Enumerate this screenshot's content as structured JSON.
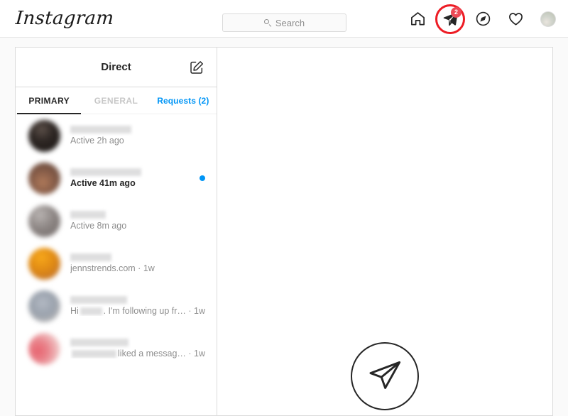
{
  "navbar": {
    "logo": "Instagram",
    "search": {
      "placeholder": "Search",
      "icon": "search-icon"
    },
    "icons": [
      {
        "name": "home-icon",
        "label": "Home"
      },
      {
        "name": "direct-messages-icon",
        "label": "Direct",
        "badge": "2",
        "annotated": true,
        "annotation_color": "#ed1c24"
      },
      {
        "name": "explore-compass-icon",
        "label": "Explore"
      },
      {
        "name": "activity-heart-icon",
        "label": "Activity"
      },
      {
        "name": "profile-avatar",
        "label": "Profile"
      }
    ],
    "badge_color": "#ed4956"
  },
  "direct": {
    "header": {
      "title": "Direct",
      "compose_icon": "compose-pencil-icon"
    },
    "tabs": [
      {
        "label": "PRIMARY",
        "state": "active"
      },
      {
        "label": "GENERAL",
        "state": "inactive"
      },
      {
        "label": "Requests (2)",
        "state": "link"
      }
    ],
    "accent_color": "#0095f6",
    "threads": [
      {
        "name": "",
        "name_redacted": true,
        "name_width": 86,
        "preview": "Active 2h ago",
        "unread": false,
        "unread_dot": false,
        "avatar_gradient": "radial-gradient(circle at 42% 30%, #5c5049 0%, #2e2724 40%, #191513 100%), radial-gradient(circle at 60% 72%, #7a3f3a 0%, #332423 70%)"
      },
      {
        "name": "",
        "name_redacted": true,
        "name_width": 100,
        "preview": "Active 41m ago",
        "unread": true,
        "unread_dot": true,
        "avatar_gradient": "radial-gradient(circle at 45% 62%, #b07a5a 0%, #8a5f4a 40%, #5a4036 100%), radial-gradient(circle at 55% 25%, #cbb29f 0%, #7e5a48 70%)"
      },
      {
        "name": "",
        "name_redacted": true,
        "name_width": 50,
        "preview": "Active 8m ago",
        "unread": false,
        "unread_dot": false,
        "avatar_gradient": "radial-gradient(circle at 36% 30%, #b9b4b2 0%, #8e8785 45%, #6e6664 100%), radial-gradient(circle at 62% 70%, #c0737f 0%, #9a7e84 65%)"
      },
      {
        "name": "",
        "name_redacted": true,
        "name_width": 58,
        "preview": "jennstrends.com · 1w",
        "unread": false,
        "unread_dot": false,
        "avatar_gradient": "radial-gradient(circle at 40% 30%, #f7a81b 0%, #e08a14 45%, #c5762a 80%), radial-gradient(circle at 78% 74%, #6b4b8f 0%, #b4865f 60%)"
      },
      {
        "name": "",
        "name_redacted": true,
        "name_width": 80,
        "preview_prefix": "Hi",
        "preview_redact_width": 54,
        "preview_suffix": ". I'm following up fr… · 1w",
        "unread": false,
        "unread_dot": false,
        "avatar_gradient": "radial-gradient(circle at 45% 40%, #b4bac4 0%, #9aa2ad 45%, #c9c2bc 100%), radial-gradient(circle at 50% 12%, #8d93a4 0%, #b9bec7 60%)"
      },
      {
        "name": "",
        "name_redacted": true,
        "name_width": 82,
        "preview_prefix": "",
        "preview_redact_width": 86,
        "preview_suffix": "liked a messag… · 1w",
        "unread": false,
        "unread_dot": false,
        "avatar_gradient": "radial-gradient(circle at 30% 56%, #e8636f 0%, #e9848c 35%, #f2d3d2 80%), radial-gradient(circle at 70% 55%, #e05a68 0%, #f0cfcd 70%)"
      }
    ]
  },
  "conversation": {
    "empty_icon": "paper-plane-circle-icon"
  }
}
